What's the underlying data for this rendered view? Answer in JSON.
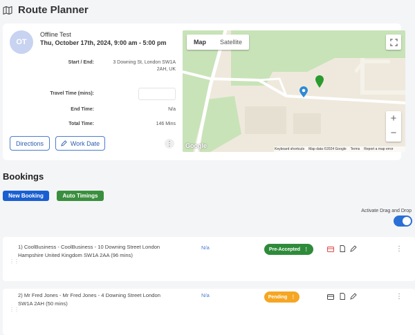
{
  "header": {
    "title": "Route Planner",
    "icon": "map-icon"
  },
  "appointment": {
    "avatar_initials": "OT",
    "client_name": "Offline Test",
    "date_time": "Thu, October 17th, 2024, 9:00 am - 5:00 pm",
    "start_end_label": "Start / End:",
    "start_end_value_line1": "3 Downing St, London SW1A",
    "start_end_value_line2": "2AH, UK",
    "travel_time_label": "Travel Time (mins):",
    "travel_time_value": "",
    "end_time_label": "End Time:",
    "end_time_value": "N/a",
    "total_time_label": "Total Time:",
    "total_time_value": "146 Mins",
    "directions_label": "Directions",
    "work_date_label": "Work Date"
  },
  "map": {
    "tab_map": "Map",
    "tab_satellite": "Satellite",
    "zoom_in": "+",
    "zoom_out": "−",
    "google_logo": "Google",
    "keyboard_shortcuts": "Keyboard shortcuts",
    "map_data": "Map data ©2024 Google",
    "terms": "Terms",
    "report": "Report a map error"
  },
  "bookings": {
    "title": "Bookings",
    "new_booking_label": "New Booking",
    "auto_timings_label": "Auto Timings",
    "drag_drop_label": "Activate Drag and Drop",
    "drag_drop_enabled": true,
    "rows": [
      {
        "line1": "1) CoolBusiness - CoolBusiness -  10 Downing Street London",
        "line2": "Hampshire United Kingdom SW1A 2AA (96 mins)",
        "travel": "N/a",
        "status": "Pre-Accepted",
        "status_color": "#2e8b3a"
      },
      {
        "line1": "2) Mr Fred Jones - Mr Fred Jones -  4 Downing Street London",
        "line2": "SW1A 2AH (50 mins)",
        "travel": "N/a",
        "status": "Pending",
        "status_color": "#f5a623"
      }
    ]
  },
  "colors": {
    "primary": "#1a5fd1",
    "success": "#3a8f3e",
    "pending": "#f5a623",
    "link": "#4a7bd0"
  }
}
